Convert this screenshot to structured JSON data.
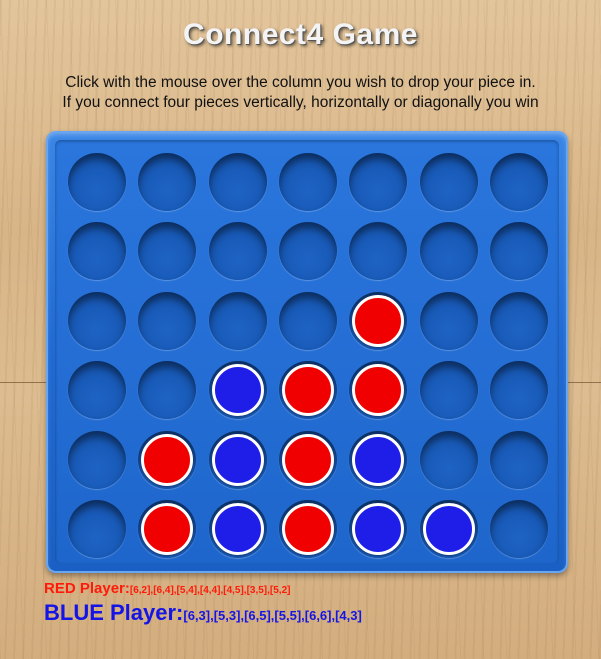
{
  "title": "Connect4 Game",
  "instructions": {
    "line1": "Click with the mouse over the column you wish to drop your piece in.",
    "line2": "If you connect four pieces vertically, horizontally or diagonally you win"
  },
  "board": {
    "columns": 7,
    "rows": 6,
    "grid": [
      [
        "",
        "",
        "",
        "",
        "",
        "",
        ""
      ],
      [
        "",
        "",
        "",
        "",
        "",
        "",
        ""
      ],
      [
        "",
        "",
        "",
        "",
        "red",
        "",
        ""
      ],
      [
        "",
        "",
        "blue",
        "red",
        "red",
        "",
        ""
      ],
      [
        "",
        "red",
        "blue",
        "red",
        "blue",
        "",
        ""
      ],
      [
        "",
        "red",
        "blue",
        "red",
        "blue",
        "blue",
        ""
      ]
    ],
    "colors": {
      "red": "#f00000",
      "blue": "#1e1ee8",
      "board": "#1f6ad3"
    }
  },
  "players": {
    "red": {
      "label": "RED Player:",
      "moves": "[6,2],[6,4],[5,4],[4,4],[4,5],[3,5],[5,2]",
      "color": "#ff1a0a"
    },
    "blue": {
      "label": "BLUE Player:",
      "moves": "[6,3],[5,3],[6,5],[5,5],[6,6],[4,3]",
      "color": "#1414e6"
    }
  }
}
